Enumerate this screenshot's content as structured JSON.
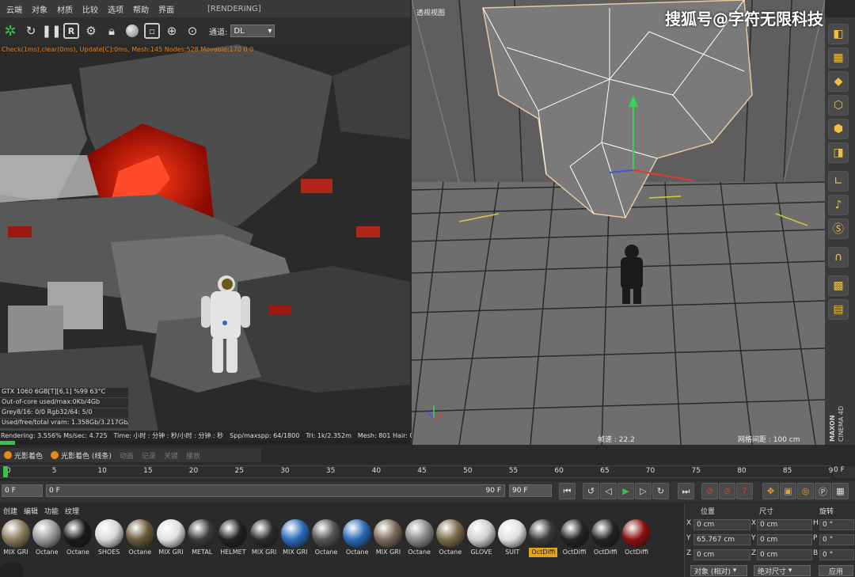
{
  "menu": {
    "items": [
      "云端",
      "对象",
      "材质",
      "比较",
      "选项",
      "帮助",
      "界面"
    ],
    "status": "[RENDERING]"
  },
  "toolbar": {
    "channel_label": "通道:",
    "channel_value": "DL"
  },
  "render": {
    "statusline": "Check(1ms),clear(0ms), Update[C]:0ms, Mesh:145 Nodes:528 Movable:170  0 0",
    "gpu": [
      "GTX 1060 6GB[T][6,1]   %99   63°C",
      "Out-of-core used/max:0Kb/4Gb",
      "Grey8/16: 0/0        Rgb32/64: 5/0",
      "Used/free/total vram: 1.358Gb/3.217Gb/6G"
    ],
    "bottom": {
      "rendering": "Rendering: 3.556% Ms/sec: 4.725",
      "time": "Time: 小时 : 分钟 : 秒/小时 : 分钟 : 秒",
      "spp": "Spp/maxspp: 64/1800",
      "tri": "Tri: 1k/2.352m",
      "mesh": "Mesh: 801 Hair: 0"
    },
    "progress": 0.036
  },
  "viewport": {
    "label": "透视视图",
    "fps": "帧速 : 22.2",
    "grid": "网格间距 : 100 cm",
    "watermark": "搜狐号@字符无限科技",
    "logo_top": "MAXON",
    "logo_bottom": "CINEMA 4D"
  },
  "materials_bar": {
    "tabs": [
      "光影着色",
      "光影着色 (线条)"
    ],
    "disabled": [
      "动画",
      "记录",
      "关键",
      "播放"
    ]
  },
  "timeline": {
    "ticks": [
      "0",
      "5",
      "10",
      "15",
      "20",
      "25",
      "30",
      "35",
      "40",
      "45",
      "50",
      "55",
      "60",
      "65",
      "70",
      "75",
      "80",
      "85",
      "90"
    ],
    "end_frame": "0 F",
    "start_field": "0 F",
    "current_field": "0 F",
    "right_field": "90 F",
    "max_field": "90 F"
  },
  "material_manager": {
    "menu": [
      "创建",
      "编辑",
      "功能",
      "纹理"
    ],
    "materials": [
      {
        "label": "MIX GRI",
        "color": "#8a7a5a"
      },
      {
        "label": "Octane",
        "color": "#9a9a9a"
      },
      {
        "label": "Octane",
        "color": "#1a1a1a"
      },
      {
        "label": "SHOES",
        "color": "#d8d8d8"
      },
      {
        "label": "Octane",
        "color": "#6a5a3a"
      },
      {
        "label": "MIX GRI",
        "color": "#e0e0e0"
      },
      {
        "label": "METAL",
        "color": "#3a3a3a"
      },
      {
        "label": "HELMET",
        "color": "#202020"
      },
      {
        "label": "MIX GRI",
        "color": "#2a2a2a"
      },
      {
        "label": "MIX GRI",
        "color": "#2a6ab8"
      },
      {
        "label": "Octane",
        "color": "#555555"
      },
      {
        "label": "Octane",
        "color": "#2a6ab8"
      },
      {
        "label": "MIX GRI",
        "color": "#7a6a5a"
      },
      {
        "label": "Octane",
        "color": "#8a8a8a"
      },
      {
        "label": "Octane",
        "color": "#7a6a4a"
      },
      {
        "label": "GLOVE",
        "color": "#d0d0d0"
      },
      {
        "label": "SUIT",
        "color": "#e0e0e0"
      },
      {
        "label": "OctDiffi",
        "color": "#3a3a3a"
      },
      {
        "label": "OctDiffi",
        "color": "#222222"
      },
      {
        "label": "OctDiffi",
        "color": "#222222"
      },
      {
        "label": "OctDiffi",
        "color": "#8a1010"
      }
    ],
    "selected_index": 17
  },
  "coordinates": {
    "headers": [
      "位置",
      "尺寸",
      "旋转"
    ],
    "rows": [
      {
        "axis": "X",
        "pos": "0 cm",
        "size_axis": "X",
        "size": "0 cm",
        "rot_axis": "H",
        "rot": "0 °"
      },
      {
        "axis": "Y",
        "pos": "65.767 cm",
        "size_axis": "Y",
        "size": "0 cm",
        "rot_axis": "P",
        "rot": "0 °"
      },
      {
        "axis": "Z",
        "pos": "0 cm",
        "size_axis": "Z",
        "size": "0 cm",
        "rot_axis": "B",
        "rot": "0 °"
      }
    ],
    "mode": "对象 (相对)",
    "size_mode": "绝对尺寸",
    "apply": "应用"
  },
  "colors": {
    "accent": "#e8a21a",
    "progress": "#39c24a",
    "status_orange": "#e07a1c"
  }
}
